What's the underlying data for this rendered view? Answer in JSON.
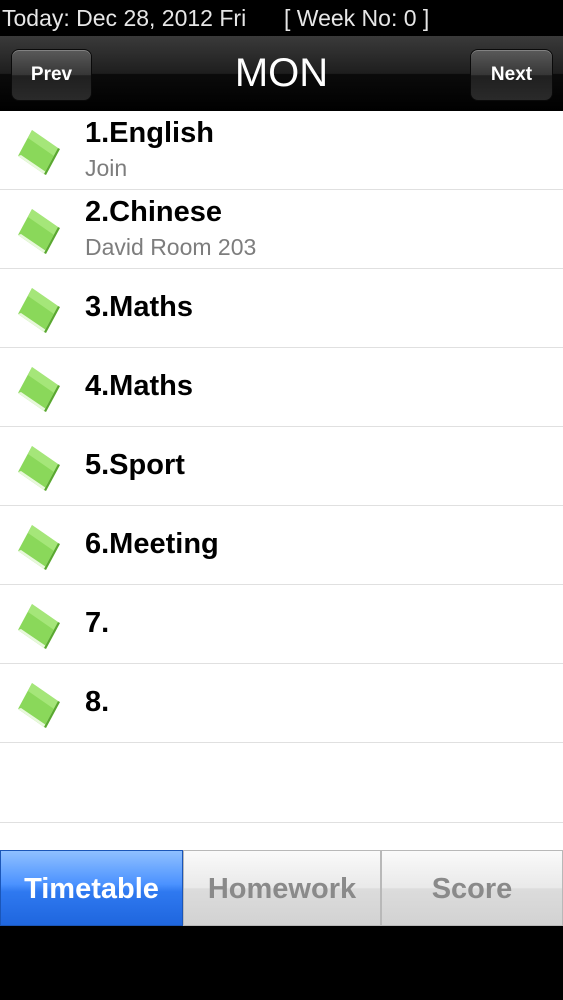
{
  "status": {
    "date_text": "Today: Dec 28, 2012 Fri",
    "week_text": "[ Week No: 0 ]"
  },
  "nav": {
    "prev_label": "Prev",
    "title": "MON",
    "next_label": "Next"
  },
  "lessons": [
    {
      "title": "1.English",
      "subtitle": "Join"
    },
    {
      "title": "2.Chinese",
      "subtitle": "David Room 203"
    },
    {
      "title": "3.Maths",
      "subtitle": ""
    },
    {
      "title": "4.Maths",
      "subtitle": ""
    },
    {
      "title": "5.Sport",
      "subtitle": ""
    },
    {
      "title": "6.Meeting",
      "subtitle": ""
    },
    {
      "title": "7.",
      "subtitle": ""
    },
    {
      "title": "8.",
      "subtitle": ""
    }
  ],
  "tabs": {
    "items": [
      "Timetable",
      "Homework",
      "Score"
    ],
    "active": "Timetable"
  },
  "icon": "book-icon",
  "colors": {
    "tab_active": "#2f79f0",
    "book_green": "#7fd24a",
    "subtitle_gray": "#7d7d7d"
  }
}
